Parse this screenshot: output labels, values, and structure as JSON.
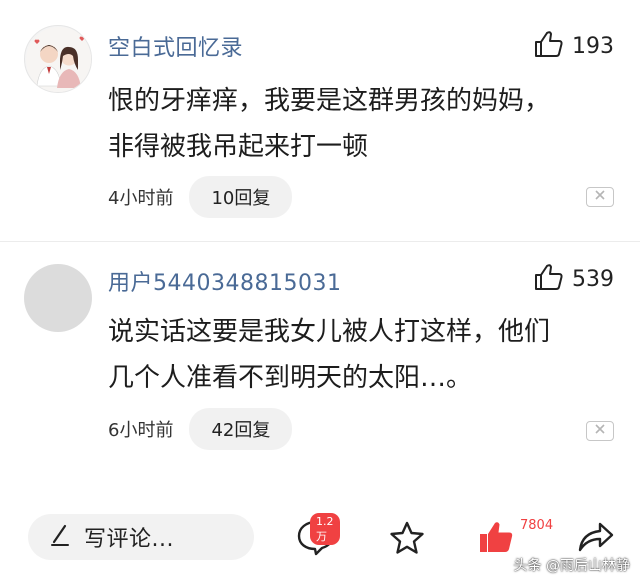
{
  "comments": [
    {
      "username": "空白式回忆录",
      "likes": "193",
      "text_line1": "恨的牙痒痒，我要是这群男孩的妈妈，",
      "text_line2": "非得被我吊起来打一顿",
      "time": "4小时前",
      "replies": "10回复"
    },
    {
      "username": "用户5440348815031",
      "likes": "539",
      "text_line1": "说实话这要是我女儿被人打这样，他们",
      "text_line2": "几个人准看不到明天的太阳…。",
      "time": "6小时前",
      "replies": "42回复"
    }
  ],
  "bottom_bar": {
    "write_placeholder": "写评论...",
    "comment_count": "1.2万",
    "like_count": "7804"
  },
  "watermark": "头条 @雨后山林静",
  "icons": {
    "like": "thumbs-up-icon",
    "dismiss": "close-icon",
    "edit": "pencil-icon",
    "comment": "comment-bubble-icon",
    "favorite": "star-icon",
    "share": "share-arrow-icon"
  },
  "colors": {
    "username": "#4a6a96",
    "accent_red": "#f04142"
  }
}
